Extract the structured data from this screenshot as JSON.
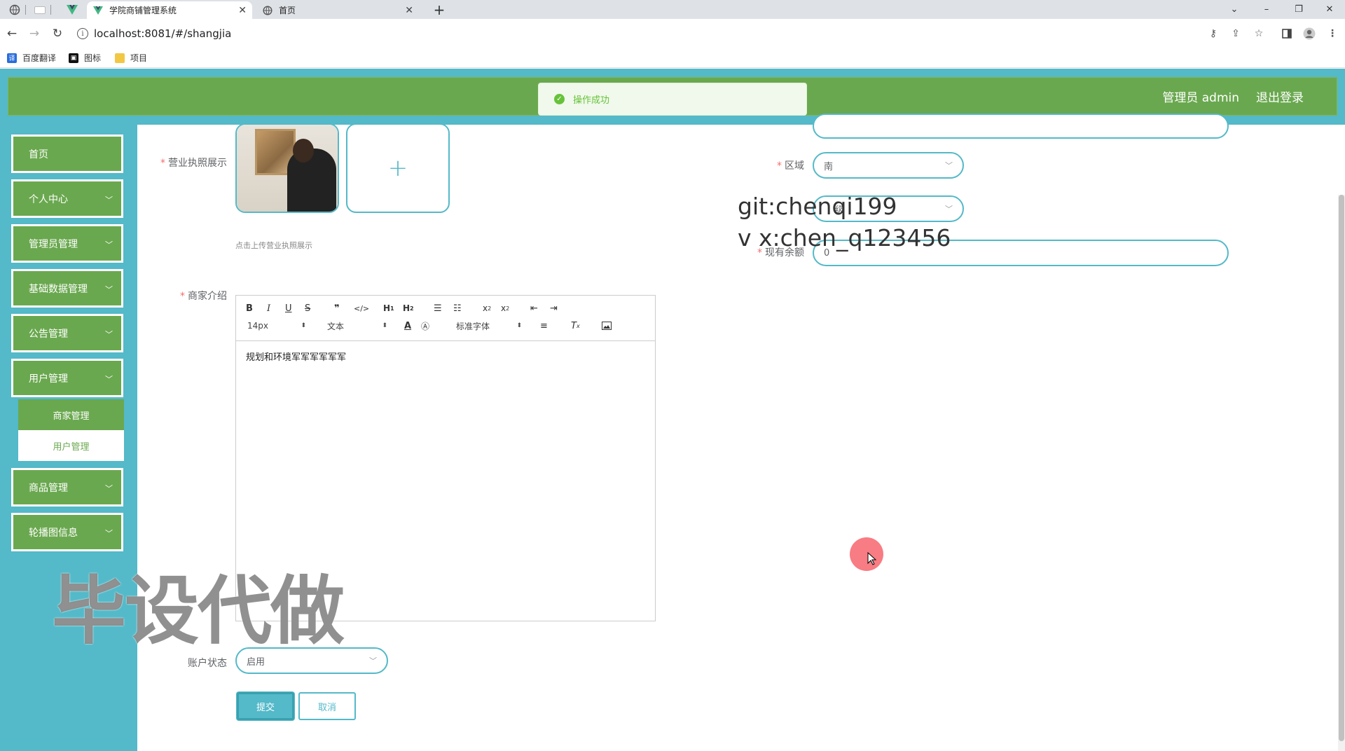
{
  "browser": {
    "tabs": [
      {
        "title": "学院商铺管理系统",
        "active": true
      },
      {
        "title": "首页",
        "active": false
      }
    ],
    "new_tab": "+",
    "url": "localhost:8081/#/shangjia",
    "bookmarks": [
      "百度翻译",
      "图标",
      "项目"
    ],
    "window_controls": {
      "tab_list": "⌄",
      "minimize": "–",
      "restore": "❐",
      "close": "✕"
    }
  },
  "header": {
    "user": "管理员 admin",
    "logout": "退出登录"
  },
  "toast": {
    "message": "操作成功"
  },
  "sidebar": {
    "items": [
      {
        "label": "首页"
      },
      {
        "label": "个人中心"
      },
      {
        "label": "管理员管理"
      },
      {
        "label": "基础数据管理"
      },
      {
        "label": "公告管理"
      },
      {
        "label": "用户管理"
      },
      {
        "label": "商品管理"
      },
      {
        "label": "轮播图信息"
      }
    ],
    "submenu": [
      {
        "label": "商家管理",
        "active": true
      },
      {
        "label": "用户管理",
        "active": false
      }
    ]
  },
  "form": {
    "license_label": "营业执照展示",
    "license_hint": "点击上传营业执照展示",
    "upload_plus": "+",
    "intro_label": "商家介绍",
    "editor": {
      "font_size": "14px",
      "block_type": "文本",
      "font_family": "标准字体",
      "content": "规划和环境军军军军军军"
    },
    "region_label": "区域",
    "region_value": "南",
    "level_value": "级",
    "balance_label": "现有余额",
    "balance_value": "0",
    "status_label": "账户状态",
    "status_value": "启用",
    "submit": "提交",
    "cancel": "取消"
  },
  "overlay": {
    "git": "git:chenqi199",
    "vx": "v x:chen_q123456",
    "watermark": "毕设代做"
  },
  "colors": {
    "teal": "#54b9c8",
    "green": "#6aa84f",
    "success": "#67c23a",
    "required": "#f56c6c"
  }
}
